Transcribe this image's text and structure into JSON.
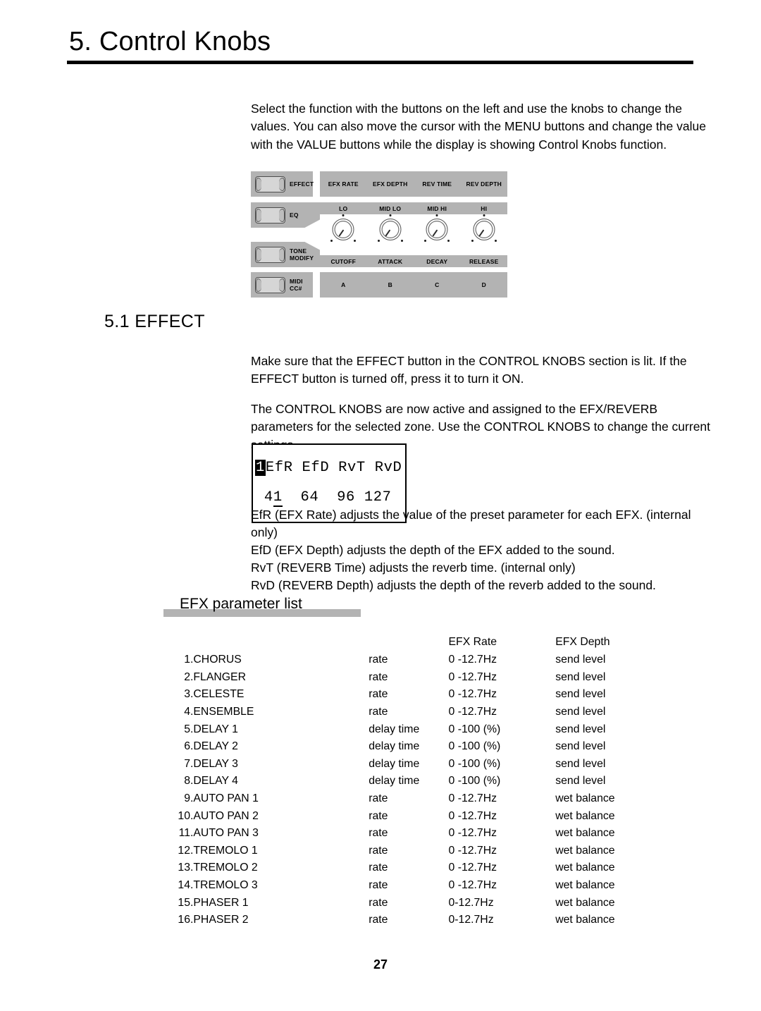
{
  "chapter": {
    "title": "5. Control Knobs"
  },
  "intro": {
    "text": "Select the function with the buttons on the left and use the knobs to change the values.  You can also move the cursor with the MENU buttons and change the value with the VALUE buttons while the display is showing Control Knobs function."
  },
  "panel": {
    "rows": [
      {
        "button": "EFFECT",
        "labels": [
          "EFX RATE",
          "EFX DEPTH",
          "REV TIME",
          "REV DEPTH"
        ]
      },
      {
        "button": "EQ",
        "labels": [
          "LO",
          "MID LO",
          "MID HI",
          "HI"
        ]
      },
      {
        "button": "TONE\nMODIFY",
        "button_line1": "TONE",
        "button_line2": "MODIFY",
        "labels": [
          "CUTOFF",
          "ATTACK",
          "DECAY",
          "RELEASE"
        ]
      },
      {
        "button_line1": "MIDI",
        "button_line2": "CC#",
        "labels": [
          "A",
          "B",
          "C",
          "D"
        ]
      }
    ],
    "colors": {
      "panel_gray": "#b3b3b3",
      "button_face": "#d6d6d6"
    }
  },
  "section": {
    "heading": "5.1 EFFECT",
    "para1": "Make sure that the EFFECT button in the CONTROL KNOBS section is lit.  If the EFFECT button is turned off, press it to turn it ON.",
    "para2": "The CONTROL KNOBS are now active and assigned to the EFX/REVERB parameters for the selected zone.  Use the CONTROL KNOBS to change the current settings."
  },
  "lcd": {
    "zone": "1",
    "line1": "EfR EfD RvT RvD",
    "value1_prefix": "4",
    "value1_cursor": "1",
    "value2": "64",
    "value3": "96",
    "value4": "127"
  },
  "descriptions": [
    "EfR (EFX Rate) adjusts the value of the preset parameter for each EFX.  (internal only)",
    "EfD (EFX Depth) adjusts the depth of the EFX added to the sound.",
    "RvT (REVERB Time) adjusts the reverb time.  (internal only)",
    "RvD (REVERB Depth) adjusts the depth of the reverb added to the sound."
  ],
  "efx_list": {
    "heading": "EFX parameter list",
    "columns": {
      "rate": "EFX Rate",
      "depth": "EFX Depth"
    },
    "rows": [
      {
        "num": "1.",
        "name": "CHORUS",
        "param": "rate",
        "range": "0 -12.7Hz",
        "depth": "send level"
      },
      {
        "num": "2.",
        "name": "FLANGER",
        "param": "rate",
        "range": "0 -12.7Hz",
        "depth": "send level"
      },
      {
        "num": "3.",
        "name": "CELESTE",
        "param": "rate",
        "range": "0 -12.7Hz",
        "depth": "send level"
      },
      {
        "num": "4.",
        "name": "ENSEMBLE",
        "param": "rate",
        "range": "0 -12.7Hz",
        "depth": "send level"
      },
      {
        "num": "5.",
        "name": "DELAY 1",
        "param": "delay time",
        "range": "0 -100 (%)",
        "depth": "send level"
      },
      {
        "num": "6.",
        "name": "DELAY 2",
        "param": "delay time",
        "range": "0 -100 (%)",
        "depth": "send level"
      },
      {
        "num": "7.",
        "name": "DELAY 3",
        "param": "delay time",
        "range": "0 -100 (%)",
        "depth": "send level"
      },
      {
        "num": "8.",
        "name": "DELAY 4",
        "param": "delay time",
        "range": "0 -100 (%)",
        "depth": "send level"
      },
      {
        "num": "9.",
        "name": "AUTO PAN 1",
        "param": "rate",
        "range": "0 -12.7Hz",
        "depth": "wet balance"
      },
      {
        "num": "10.",
        "name": "AUTO PAN 2",
        "param": "rate",
        "range": "0 -12.7Hz",
        "depth": "wet balance"
      },
      {
        "num": "11.",
        "name": "AUTO PAN 3",
        "param": "rate",
        "range": "0 -12.7Hz",
        "depth": "wet balance"
      },
      {
        "num": "12.",
        "name": "TREMOLO 1",
        "param": "rate",
        "range": "0 -12.7Hz",
        "depth": "wet balance"
      },
      {
        "num": "13.",
        "name": "TREMOLO 2",
        "param": "rate",
        "range": "0 -12.7Hz",
        "depth": "wet balance"
      },
      {
        "num": "14.",
        "name": "TREMOLO 3",
        "param": "rate",
        "range": "0 -12.7Hz",
        "depth": "wet balance"
      },
      {
        "num": "15.",
        "name": "PHASER 1",
        "param": "rate",
        "range": "0-12.7Hz",
        "depth": "wet balance"
      },
      {
        "num": "16.",
        "name": "PHASER 2",
        "param": "rate",
        "range": "0-12.7Hz",
        "depth": "wet balance"
      }
    ]
  },
  "footer": {
    "page_number": "27"
  }
}
